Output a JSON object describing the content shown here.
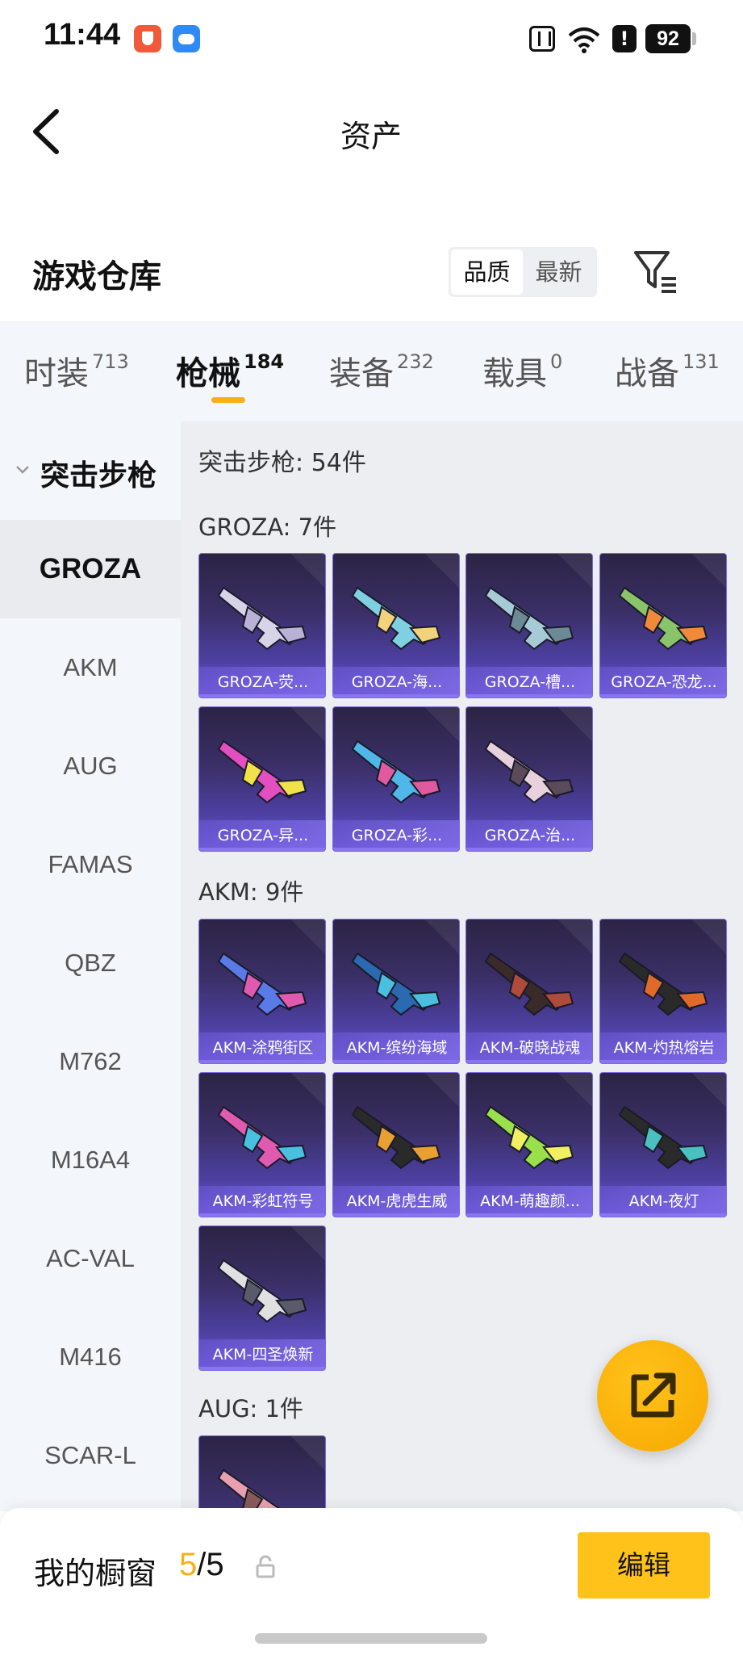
{
  "status_bar": {
    "time": "11:44",
    "battery": "92",
    "alert": "!"
  },
  "header": {
    "title": "资产"
  },
  "warehouse": {
    "title": "游戏仓库",
    "sort_options": [
      "品质",
      "最新"
    ],
    "sort_selected": "品质"
  },
  "category_tabs": [
    {
      "label": "时装",
      "count": "713"
    },
    {
      "label": "枪械",
      "count": "184",
      "active": true
    },
    {
      "label": "装备",
      "count": "232"
    },
    {
      "label": "载具",
      "count": "0"
    },
    {
      "label": "战备",
      "count": "131"
    }
  ],
  "sidebar": {
    "group": "突击步枪",
    "items": [
      "GROZA",
      "AKM",
      "AUG",
      "FAMAS",
      "QBZ",
      "M762",
      "M16A4",
      "AC-VAL",
      "M416",
      "SCAR-L"
    ],
    "selected": "GROZA"
  },
  "main": {
    "summary": "突击步枪: 54件",
    "groups": [
      {
        "title": "GROZA: 7件",
        "items": [
          "GROZA-荧...",
          "GROZA-海...",
          "GROZA-槽...",
          "GROZA-恐龙...",
          "GROZA-异...",
          "GROZA-彩...",
          "GROZA-治..."
        ]
      },
      {
        "title": "AKM: 9件",
        "items": [
          "AKM-涂鸦街区",
          "AKM-缤纷海域",
          "AKM-破晓战魂",
          "AKM-灼热熔岩",
          "AKM-彩虹符号",
          "AKM-虎虎生威",
          "AKM-萌趣颜...",
          "AKM-夜灯",
          "AKM-四圣焕新"
        ]
      },
      {
        "title": "AUG: 1件",
        "items": [
          ""
        ]
      }
    ]
  },
  "showcase": {
    "label": "我的橱窗",
    "used": "5",
    "separator": "/",
    "total": "5",
    "edit_label": "编辑"
  },
  "colors": {
    "accent": "#f7b117",
    "card_purple": "#4e40a3",
    "sidebar_bg": "#f3f6fb"
  }
}
